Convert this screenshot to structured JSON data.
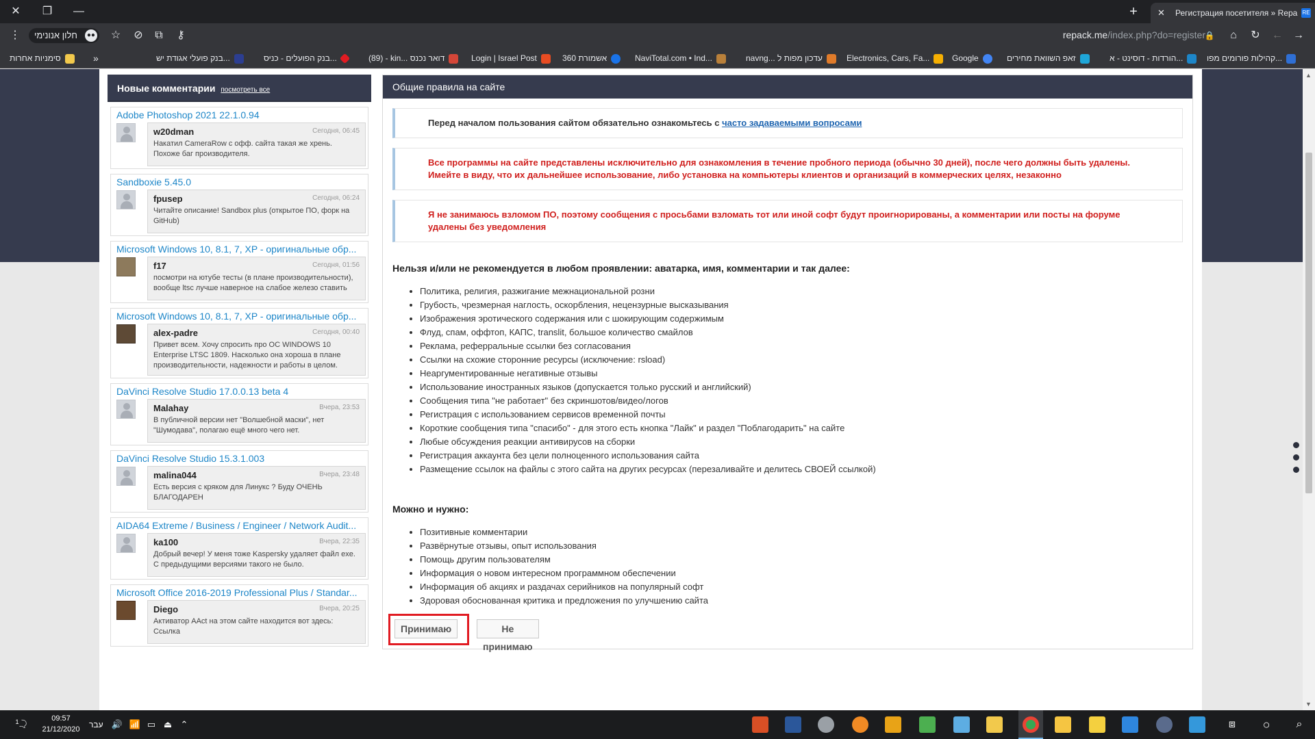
{
  "browser": {
    "tab_title": "Регистрация посетителя » Repa",
    "tab_favicon_text": "RE",
    "incognito_label": "חלון אנונימי",
    "url_host": "repack.me",
    "url_path": "/index.php?do=register",
    "bookmarks": [
      {
        "label": "סימניות אחרות",
        "icon": "folder-icon",
        "color": "#f2c94c"
      },
      {
        "label": "»",
        "icon": "",
        "color": ""
      },
      {
        "label": "בנק פועלי אגודת יש...",
        "icon": "bank-icon",
        "color": "#2c3e91"
      },
      {
        "label": "בנק הפועלים - כניס...",
        "icon": "bank-icon",
        "color": "#e11b22"
      },
      {
        "label": "(89) - kin... דואר נכנס",
        "icon": "gmail-icon",
        "color": "#d44638"
      },
      {
        "label": "Login | Israel Post",
        "icon": "post-icon",
        "color": "#e84c22"
      },
      {
        "label": "אשמורת 360",
        "icon": "shield-icon",
        "color": "#1a73e8"
      },
      {
        "label": "NaviTotal.com • Ind...",
        "icon": "navitotal-icon",
        "color": "#b9803a"
      },
      {
        "label": "navng... עדכון מפות ל",
        "icon": "map-icon",
        "color": "#e07b2a"
      },
      {
        "label": "Electronics, Cars, Fa...",
        "icon": "ebay-icon",
        "color": "#f5af02"
      },
      {
        "label": "Google",
        "icon": "google-icon",
        "color": "#4285f4"
      },
      {
        "label": "זאפ השוואת מחירים",
        "icon": "zap-icon",
        "color": "#1ea6d8"
      },
      {
        "label": "הורדות - דוסינט - א...",
        "icon": "download-icon",
        "color": "#1d86c8"
      },
      {
        "label": "קהילות פורומים מפו...",
        "icon": "forum-icon",
        "color": "#2f6fd4"
      }
    ]
  },
  "sidebar": {
    "title": "Новые комментарии",
    "see_all": "посмотреть все",
    "comments": [
      {
        "title": "Adobe Photoshop 2021 22.1.0.94",
        "user": "w20dman",
        "time": "Сегодня, 06:45",
        "text": "Накатил CameraRow с офф. сайта такая же хрень. Похоже баг производителя.",
        "avatar": "default"
      },
      {
        "title": "Sandboxie 5.45.0",
        "user": "fpusep",
        "time": "Сегодня, 06:24",
        "text": "Читайте описание! Sandbox plus (открытое ПО, форк на GitHub)",
        "avatar": "default"
      },
      {
        "title": "Microsoft Windows 10, 8.1, 7, XP - оригинальные обр...",
        "user": "f17",
        "time": "Сегодня, 01:56",
        "text": "посмотри на ютубе тесты (в плане производительности), вообще ltsc лучше наверное на слабое железо ставить",
        "avatar": "cat"
      },
      {
        "title": "Microsoft Windows 10, 8.1, 7, XP - оригинальные обр...",
        "user": "alex-padre",
        "time": "Сегодня, 00:40",
        "text": "Привет всем. Хочу спросить про ОС WINDOWS 10 Enterprise LTSC 1809. Насколько она хороша в плане производительности, надежности и работы в целом.",
        "avatar": "photo"
      },
      {
        "title": "DaVinci Resolve Studio 17.0.0.13 beta 4",
        "user": "Malahay",
        "time": "Вчера, 23:53",
        "text": "В публичной версии нет \"Волшебной маски\", нет \"Шумодава\", полагаю ещё много чего нет.",
        "avatar": "default"
      },
      {
        "title": "DaVinci Resolve Studio 15.3.1.003",
        "user": "malina044",
        "time": "Вчера, 23:48",
        "text": "Есть версия с кряком для Линукс ? Буду ОЧЕНЬ БЛАГОДАРЕН",
        "avatar": "default"
      },
      {
        "title": "AIDA64 Extreme / Business / Engineer / Network Audit...",
        "user": "ka100",
        "time": "Вчера, 22:35",
        "text": "Добрый вечер! У меня тоже Kaspersky удаляет файл exe. С предыдущими версиями такого не было.",
        "avatar": "default"
      },
      {
        "title": "Microsoft Office 2016-2019 Professional Plus / Standar...",
        "user": "Diego",
        "time": "Вчера, 20:25",
        "text": "Активатор AAct на этом сайте находится вот здесь: Ссылка",
        "avatar": "face"
      }
    ]
  },
  "main": {
    "title": "Общие правила на сайте",
    "notice_info_prefix": "Перед началом пользования сайтом обязательно ознакомьтесь с",
    "notice_info_link": "часто задаваемыми вопросами",
    "notice_warn_1": "Все программы на сайте представлены исключительно для ознакомления в течение пробного периода (обычно 30 дней), после чего должны быть удалены. Имейте в виду, что их дальнейшее использование, либо установка на компьютеры клиентов и организаций в коммерческих целях, незаконно",
    "notice_warn_2": "Я не занимаюсь взломом ПО, поэтому сообщения с просьбами взломать тот или иной софт будут проигнорированы, а комментарии или посты на форуме удалены без уведомления",
    "forbid_title": "Нельзя и/или не рекомендуется в любом проявлении: аватарка, имя, комментарии и так далее:",
    "forbid_items": [
      "Политика, религия, разжигание межнациональной розни",
      "Грубость, чрезмерная наглость, оскорбления, нецензурные высказывания",
      "Изображения эротического содержания или с шокирующим содержимым",
      "Флуд, спам, оффтоп, КАПС, translit, большое количество смайлов",
      "Реклама, реферральные ссылки без согласования",
      "Ссылки на схожие сторонние ресурсы (исключение: rsload)",
      "Неаргументированные негативные отзывы",
      "Использование иностранных языков (допускается только русский и английский)",
      "Сообщения типа \"не работает\" без скриншотов/видео/логов",
      "Регистрация с использованием сервисов временной почты",
      "Короткие сообщения типа \"спасибо\" - для этого есть кнопка \"Лайк\" и раздел \"Поблагодарить\" на сайте",
      "Любые обсуждения реакции антивирусов на сборки",
      "Регистрация аккаунта без цели полноценного использования сайта",
      "Размещение ссылок на файлы с этого сайта на других ресурсах (перезаливайте и делитесь СВОЕЙ ссылкой)"
    ],
    "allow_title": "Можно и нужно:",
    "allow_items": [
      "Позитивные комментарии",
      "Развёрнутые отзывы, опыт использования",
      "Помощь другим пользователям",
      "Информация о новом интересном программном обеспечении",
      "Информация об акциях и раздачах серийников на популярный софт",
      "Здоровая обоснованная критика и предложения по улучшению сайта"
    ],
    "accept_label": "Принимаю",
    "decline_label": "Не принимаю"
  },
  "taskbar": {
    "time": "09:57",
    "date": "21/12/2020",
    "lang": "עבר",
    "notification_count": "1"
  }
}
